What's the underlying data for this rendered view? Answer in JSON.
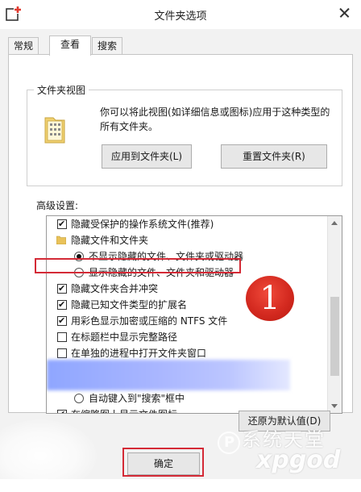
{
  "window": {
    "title": "文件夹选项",
    "app_icon": "folder-options-icon",
    "close_icon": "close-icon"
  },
  "tabs": [
    {
      "label": "常规",
      "active": false
    },
    {
      "label": "查看",
      "active": true
    },
    {
      "label": "搜索",
      "active": false
    }
  ],
  "folder_views": {
    "legend": "文件夹视图",
    "description": "你可以将此视图(如详细信息或图标)应用于这种类型的所有文件夹。",
    "apply_button": "应用到文件夹(L)",
    "reset_button": "重置文件夹(R)"
  },
  "advanced": {
    "label": "高级设置:",
    "items": [
      {
        "type": "checkbox",
        "checked": true,
        "indent": 0,
        "label": "隐藏受保护的操作系统文件(推荐)"
      },
      {
        "type": "folder",
        "indent": 0,
        "label": "隐藏文件和文件夹"
      },
      {
        "type": "radio",
        "checked": true,
        "indent": 1,
        "label": "不显示隐藏的文件、文件夹或驱动器"
      },
      {
        "type": "radio",
        "checked": false,
        "indent": 1,
        "label": "显示隐藏的文件、文件夹和驱动器"
      },
      {
        "type": "checkbox",
        "checked": true,
        "indent": 0,
        "label": "隐藏文件夹合并冲突"
      },
      {
        "type": "checkbox",
        "checked": true,
        "indent": 0,
        "label": "隐藏已知文件类型的扩展名"
      },
      {
        "type": "checkbox",
        "checked": true,
        "indent": 0,
        "label": "用彩色显示加密或压缩的 NTFS 文件",
        "highlighted": true
      },
      {
        "type": "checkbox",
        "checked": false,
        "indent": 0,
        "label": "在标题栏中显示完整路径"
      },
      {
        "type": "checkbox",
        "checked": false,
        "indent": 0,
        "label": "在单独的进程中打开文件夹窗口"
      },
      {
        "type": "radio",
        "checked": false,
        "indent": 1,
        "label": "自动键入到\"搜索\"框中"
      },
      {
        "type": "checkbox",
        "checked": true,
        "indent": 0,
        "label": "在缩略图上显示文件图标"
      }
    ]
  },
  "annotation": {
    "badge_number": "1",
    "color": "#d42a36"
  },
  "buttons": {
    "restore_defaults": "还原为默认值(D)",
    "ok": "确定"
  },
  "watermark": {
    "line1": "系统天堂",
    "line2": "xpgod"
  },
  "colors": {
    "window_bg": "#f2f2f2",
    "highlight_red": "#d42a36",
    "blurred_row": "#a9b6ff"
  }
}
